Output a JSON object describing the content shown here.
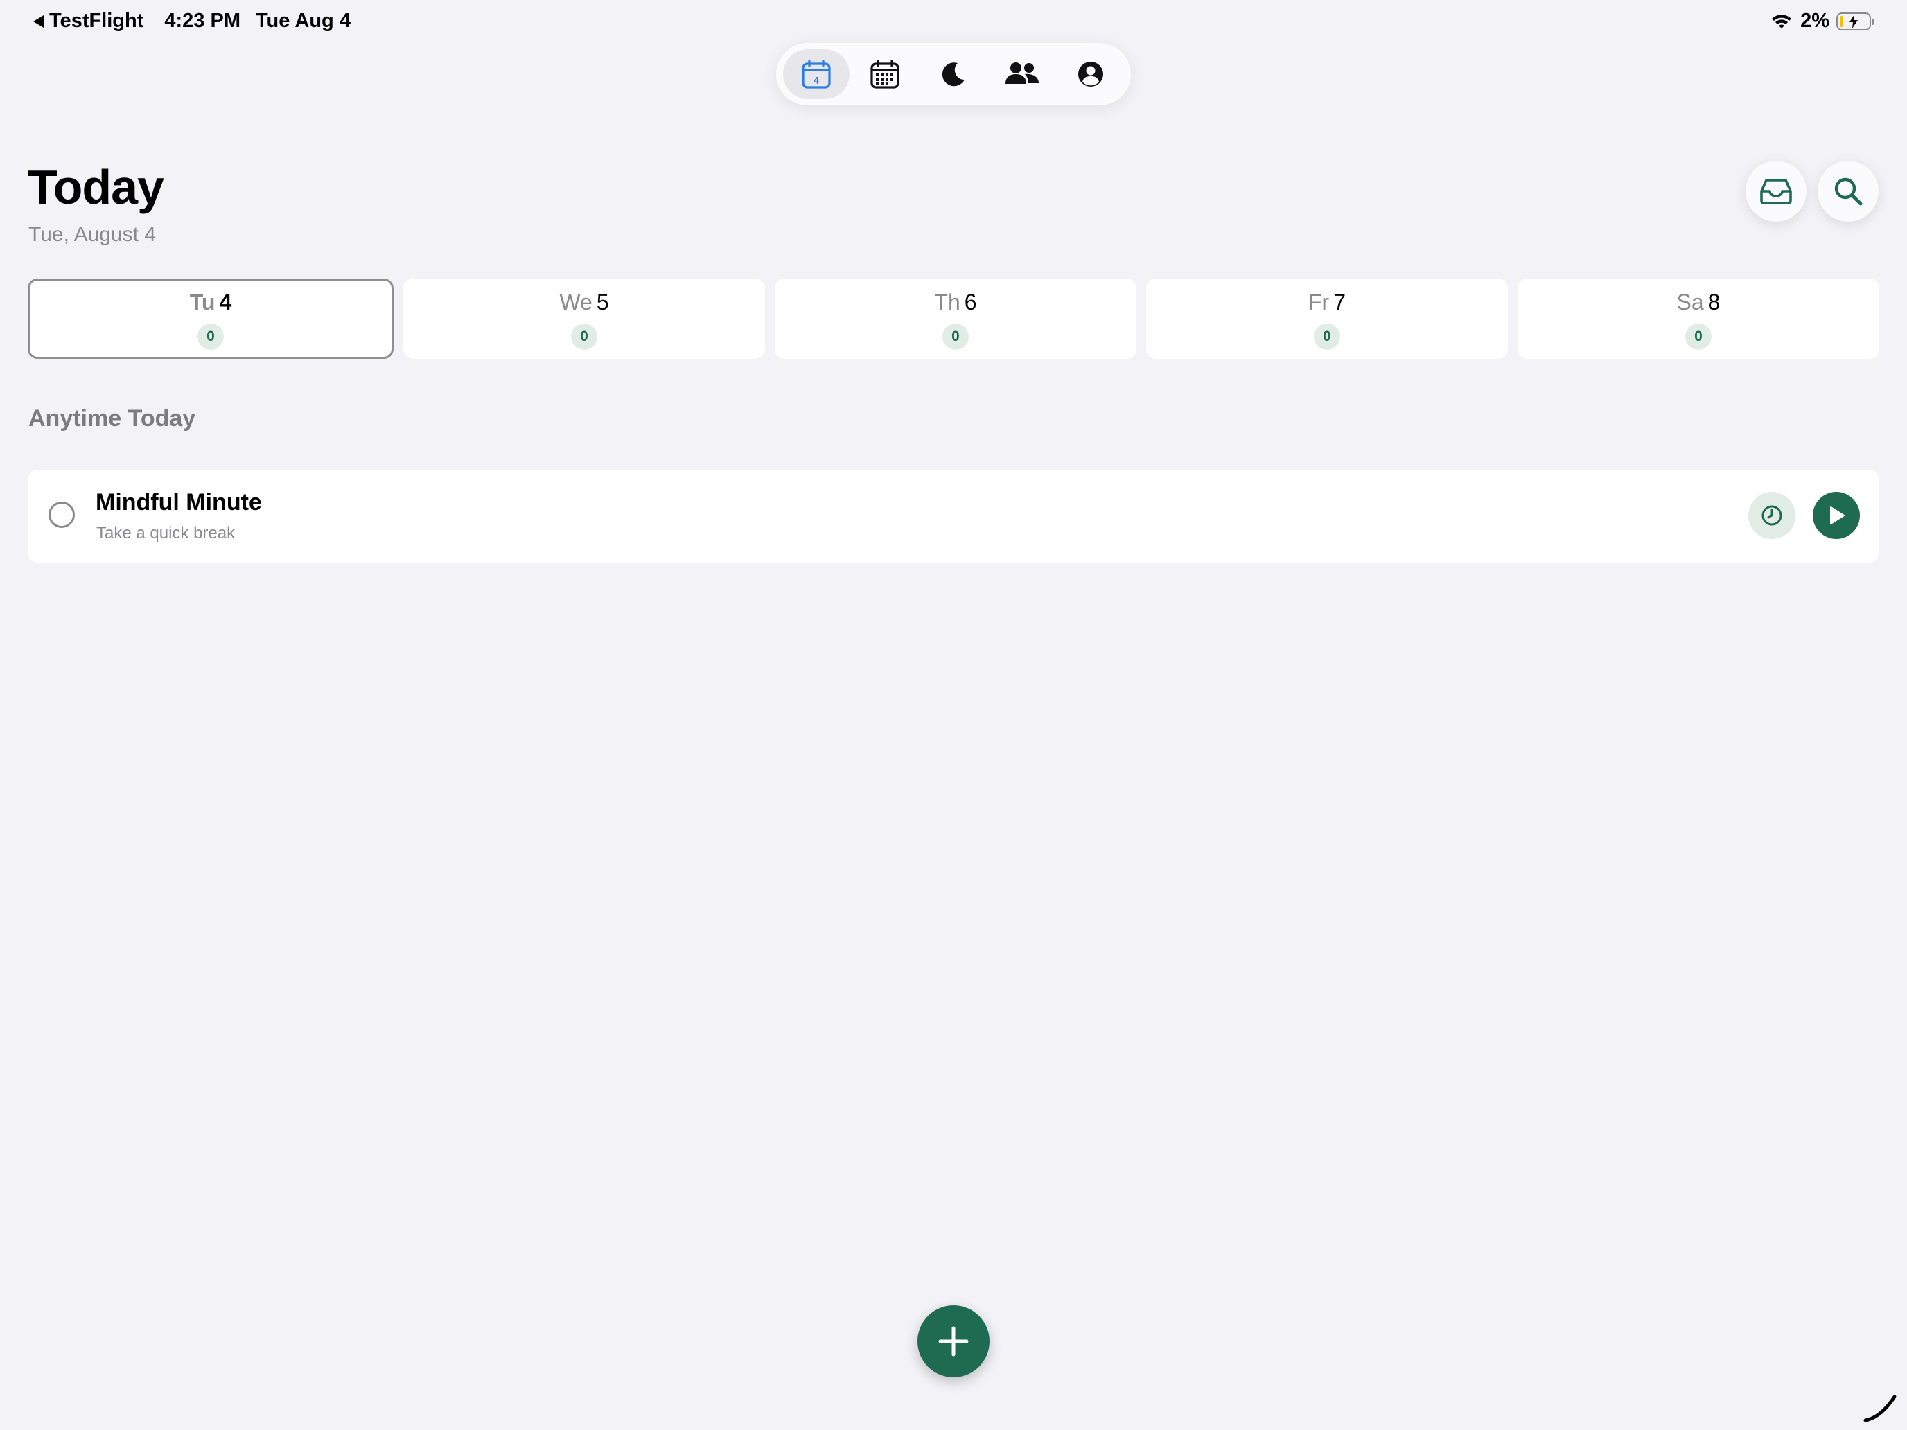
{
  "status_bar": {
    "back_app": "TestFlight",
    "time": "4:23 PM",
    "date": "Tue Aug 4",
    "battery_percent": "2%",
    "battery_level": 0.02
  },
  "tabbar": {
    "calendar_today_day": "4",
    "active_tab": "today"
  },
  "header": {
    "title": "Today",
    "subtitle": "Tue, August 4"
  },
  "week": [
    {
      "abbr": "Tu",
      "num": "4",
      "count": "0",
      "selected": true
    },
    {
      "abbr": "We",
      "num": "5",
      "count": "0",
      "selected": false
    },
    {
      "abbr": "Th",
      "num": "6",
      "count": "0",
      "selected": false
    },
    {
      "abbr": "Fr",
      "num": "7",
      "count": "0",
      "selected": false
    },
    {
      "abbr": "Sa",
      "num": "8",
      "count": "0",
      "selected": false
    }
  ],
  "section": {
    "title": "Anytime Today"
  },
  "task": {
    "title": "Mindful Minute",
    "subtitle": "Take a quick break"
  },
  "colors": {
    "accent_green": "#1f6b51",
    "badge_bg": "#e1ece6",
    "tab_active_blue": "#2a7de1",
    "background": "#f2f2f7"
  },
  "icons": {
    "tabs": [
      "calendar-today-icon",
      "calendar-month-icon",
      "moon-icon",
      "people-icon",
      "profile-icon"
    ],
    "header_actions": [
      "inbox-icon",
      "search-icon"
    ],
    "task_actions": [
      "clock-icon",
      "play-icon"
    ],
    "fab": "plus-icon"
  }
}
